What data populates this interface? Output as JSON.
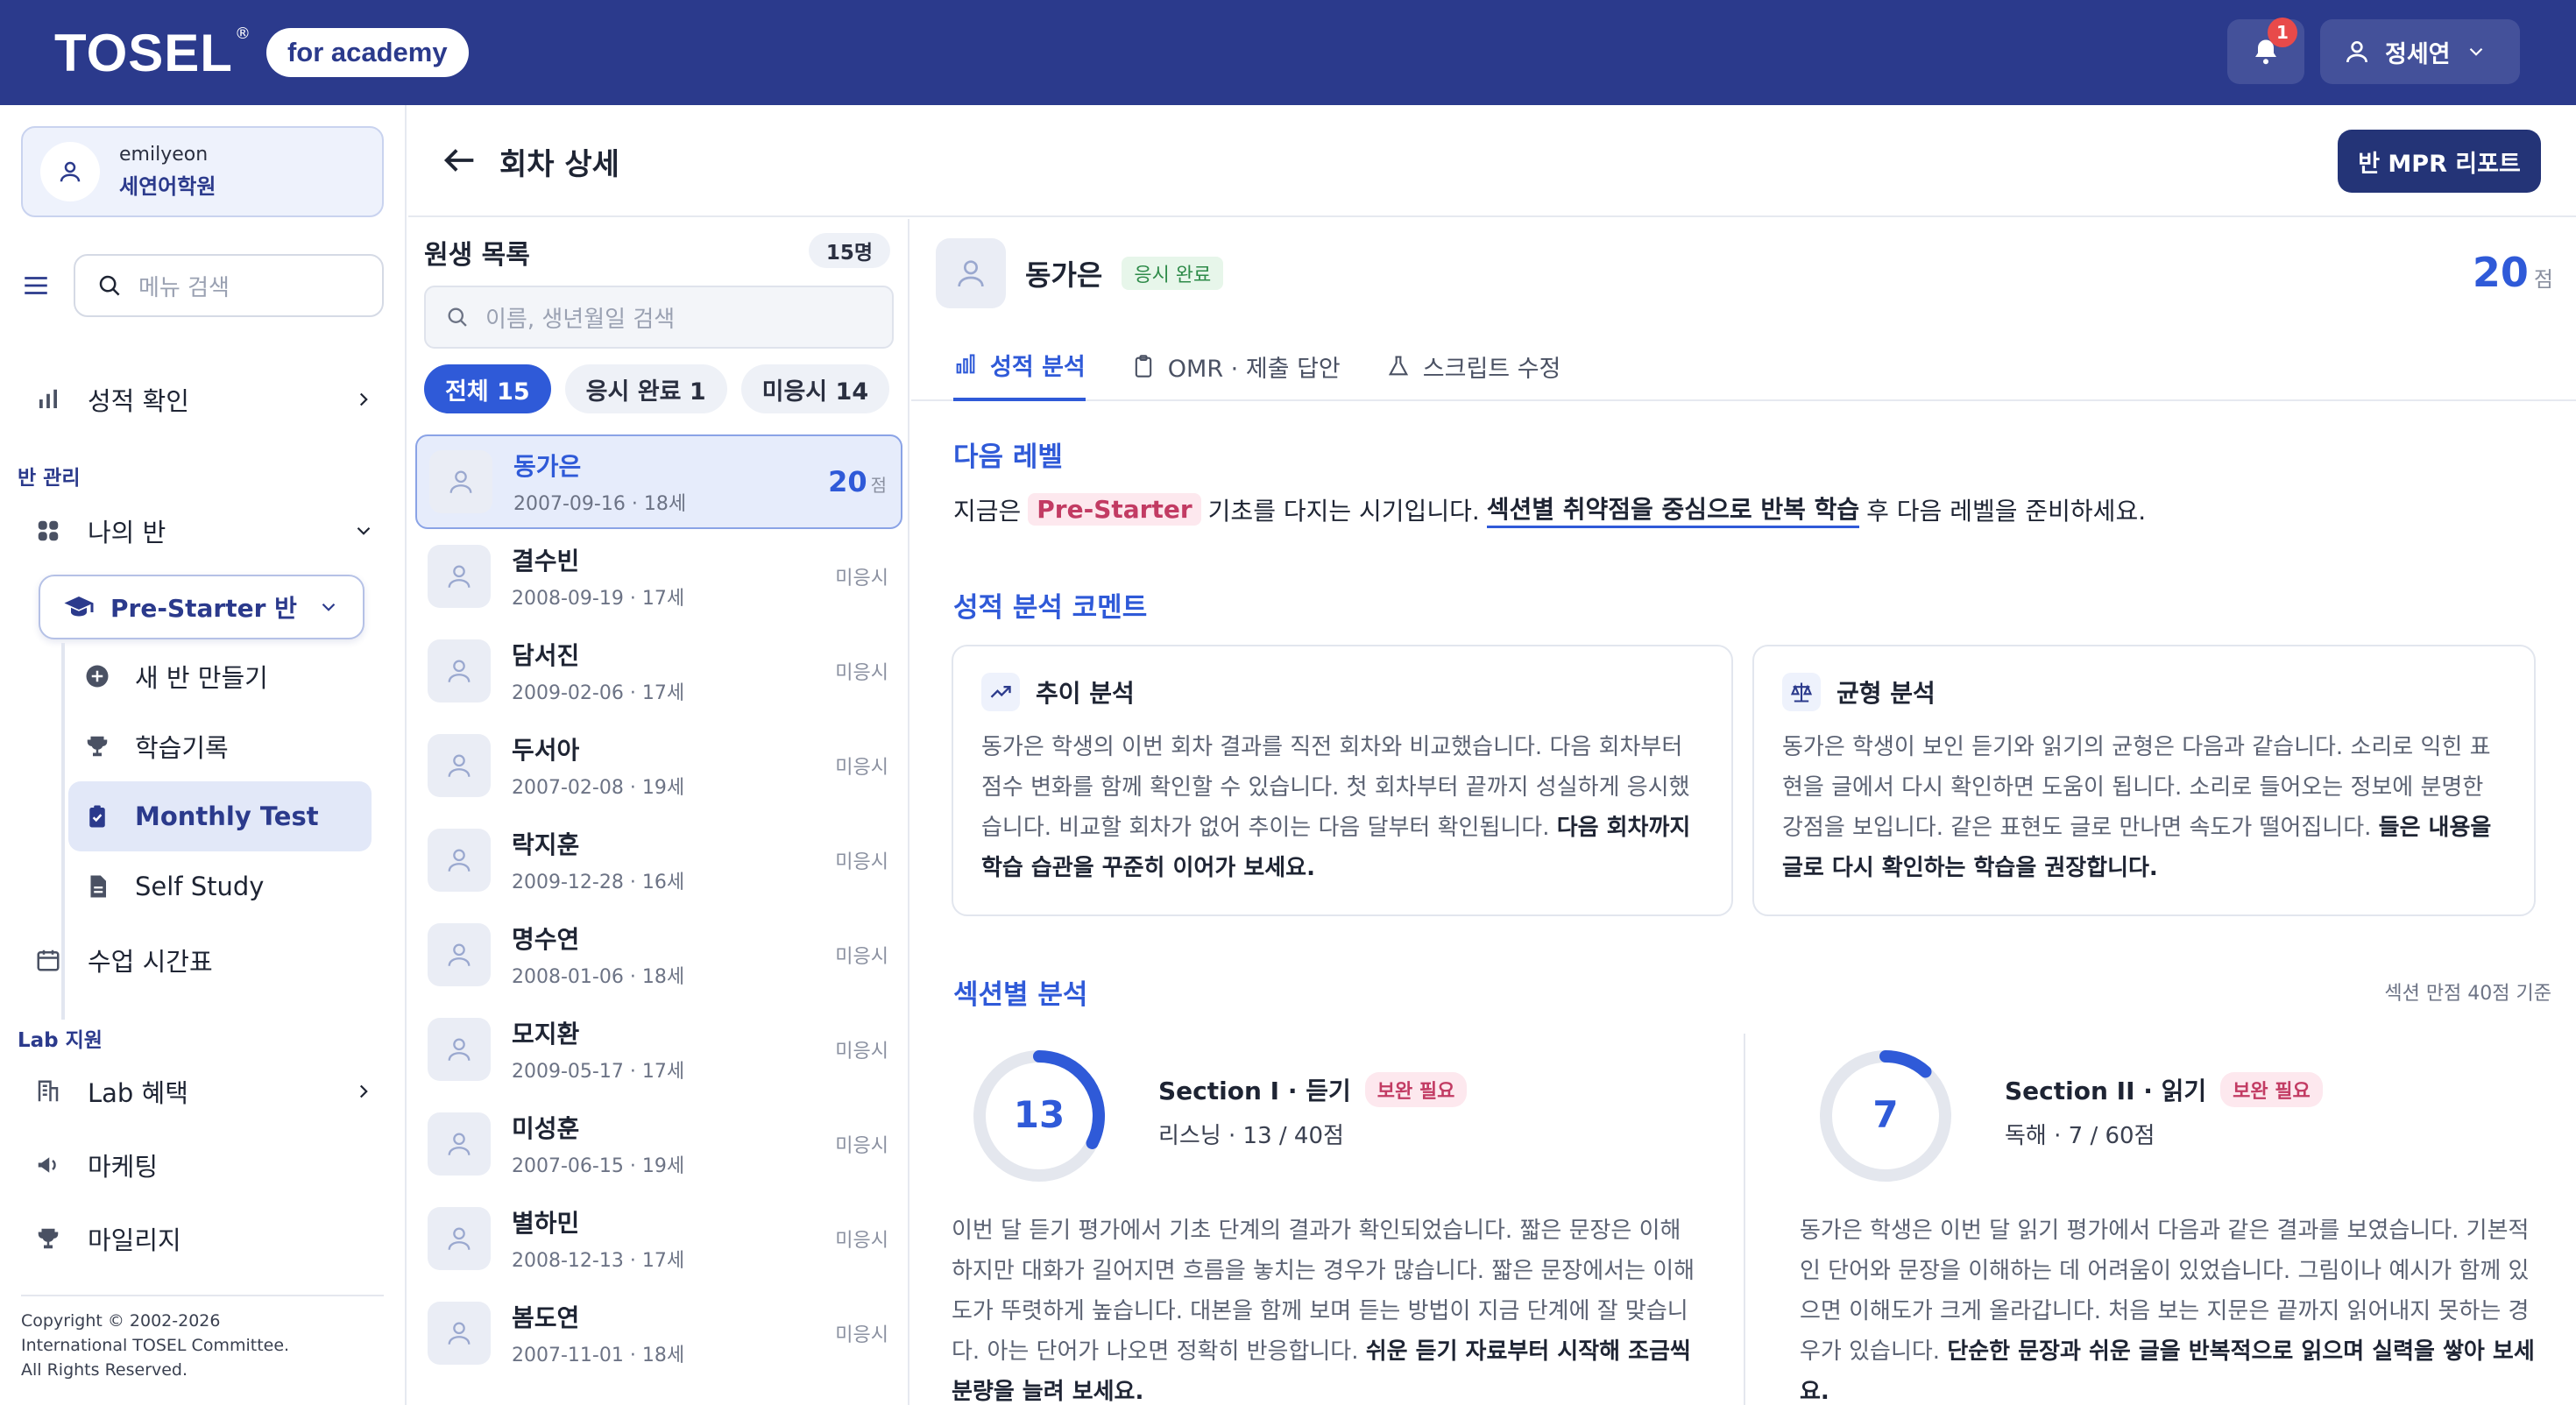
{
  "header": {
    "logo": "TOSEL",
    "logo_reg": "®",
    "logo_pill": "for academy",
    "notif_count": "1",
    "user_name": "정세연"
  },
  "sidebar": {
    "account_id": "emilyeon",
    "academy": "세연어학원",
    "search_placeholder": "메뉴 검색",
    "score_check": "성적 확인",
    "class_mgmt_title": "반 관리",
    "my_class": "나의 반",
    "selected_class": "Pre-Starter 반",
    "sub_items": [
      "새 반 만들기",
      "학습기록",
      "Monthly Test",
      "Self Study"
    ],
    "timetable": "수업 시간표",
    "lab_title": "Lab 지원",
    "lab_items": [
      "Lab 혜택",
      "마케팅",
      "마일리지"
    ],
    "copyright": [
      "Copyright © 2002-2026",
      "International TOSEL Committee.",
      "All Rights Reserved."
    ]
  },
  "page": {
    "title": "회차 상세",
    "mpr_button": "반 MPR 리포트"
  },
  "list": {
    "title": "원생 목록",
    "count": "15명",
    "search_placeholder": "이름, 생년월일 검색",
    "filters": [
      "전체 15",
      "응시 완료 1",
      "미응시 14"
    ],
    "students": [
      {
        "name": "동가은",
        "meta": "2007-09-16 · 18세",
        "score": "20",
        "unit": "점"
      },
      {
        "name": "결수빈",
        "meta": "2008-09-19 · 17세",
        "status": "미응시"
      },
      {
        "name": "담서진",
        "meta": "2009-02-06 · 17세",
        "status": "미응시"
      },
      {
        "name": "두서아",
        "meta": "2007-02-08 · 19세",
        "status": "미응시"
      },
      {
        "name": "락지훈",
        "meta": "2009-12-28 · 16세",
        "status": "미응시"
      },
      {
        "name": "명수연",
        "meta": "2008-01-06 · 18세",
        "status": "미응시"
      },
      {
        "name": "모지환",
        "meta": "2009-05-17 · 17세",
        "status": "미응시"
      },
      {
        "name": "미성훈",
        "meta": "2007-06-15 · 19세",
        "status": "미응시"
      },
      {
        "name": "별하민",
        "meta": "2008-12-13 · 17세",
        "status": "미응시"
      },
      {
        "name": "봄도연",
        "meta": "2007-11-01 · 18세",
        "status": "미응시"
      }
    ]
  },
  "detail": {
    "name": "동가은",
    "status": "응시 완료",
    "score": "20",
    "unit": "점",
    "tabs": [
      "성적 분석",
      "OMR · 제출 답안",
      "스크립트 수정"
    ],
    "next_level": {
      "title": "다음 레벨",
      "pre": "지금은",
      "tag": "Pre-Starter",
      "mid": "기초를 다지는 시기입니다.",
      "strong": "섹션별 취약점을 중심으로 반복 학습",
      "post": "후 다음 레벨을 준비하세요."
    },
    "comment_title": "성적 분석 코멘트",
    "cards": [
      {
        "title": "추이 분석",
        "body": "동가은 학생의 이번 회차 결과를 직전 회차와 비교했습니다. 다음 회차부터 점수 변화를 함께 확인할 수 있습니다. 첫 회차부터 끝까지 성실하게 응시했습니다. 비교할 회차가 없어 추이는 다음 달부터 확인됩니다.",
        "bold": "다음 회차까지 학습 습관을 꾸준히 이어가 보세요."
      },
      {
        "title": "균형 분석",
        "body": "동가은 학생이 보인 듣기와 읽기의 균형은 다음과 같습니다. 소리로 익힌 표현을 글에서 다시 확인하면 도움이 됩니다. 소리로 들어오는 정보에 분명한 강점을 보입니다. 같은 표현도 글로 만나면 속도가 떨어집니다.",
        "bold": "들은 내용을 글로 다시 확인하는 학습을 권장합니다."
      }
    ],
    "section_title": "섹션별 분석",
    "section_basis": "섹션 만점 40점 기준",
    "sections": [
      {
        "score": "13",
        "max": 40,
        "value": 13,
        "name": "Section I · 듣기",
        "tag": "보완 필요",
        "sub": "리스닝 · 13 / 40점",
        "body": "이번 달 듣기 평가에서 기초 단계의 결과가 확인되었습니다. 짧은 문장은 이해하지만 대화가 길어지면 흐름을 놓치는 경우가 많습니다. 짧은 문장에서는 이해도가 뚜렷하게 높습니다. 대본을 함께 보며 듣는 방법이 지금 단계에 잘 맞습니다. 아는 단어가 나오면 정확히 반응합니다.",
        "bold": "쉬운 듣기 자료부터 시작해 조금씩 분량을 늘려 보세요."
      },
      {
        "score": "7",
        "max": 60,
        "value": 7,
        "name": "Section II · 읽기",
        "tag": "보완 필요",
        "sub": "독해 · 7 / 60점",
        "body": "동가은 학생은 이번 달 읽기 평가에서 다음과 같은 결과를 보였습니다. 기본적인 단어와 문장을 이해하는 데 어려움이 있었습니다. 그림이나 예시가 함께 있으면 이해도가 크게 올라갑니다. 처음 보는 지문은 끝까지 읽어내지 못하는 경우가 있습니다.",
        "bold": "단순한 문장과 쉬운 글을 반복적으로 읽으며 실력을 쌓아 보세요."
      }
    ]
  },
  "colors": {
    "brand": "#2b3a8c",
    "accent": "#2f5ad8",
    "warn": "#c23b63",
    "ok": "#2e8b49"
  }
}
